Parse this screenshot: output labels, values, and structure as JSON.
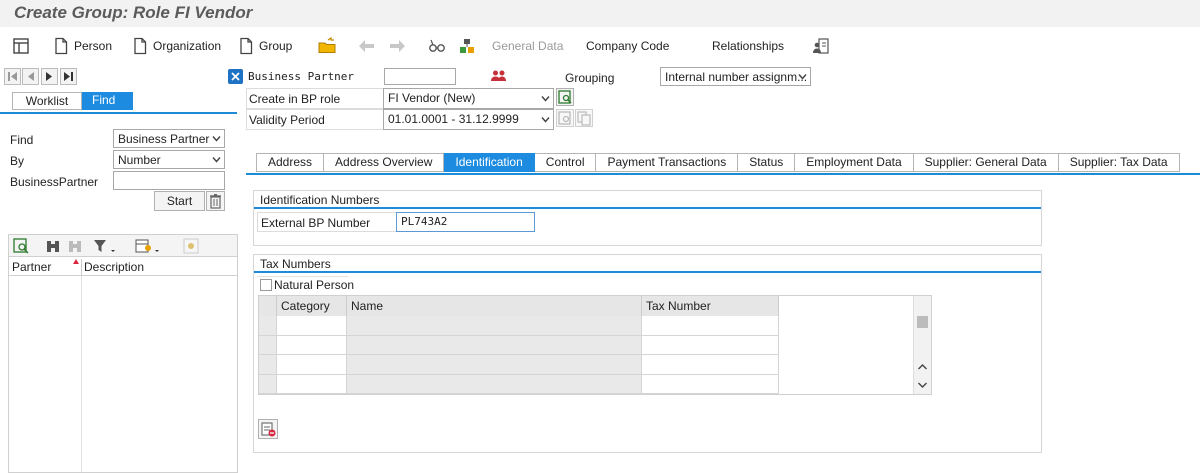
{
  "title": "Create Group: Role FI Vendor",
  "toolbar": {
    "person": "Person",
    "organization": "Organization",
    "group": "Group",
    "general_data": "General Data",
    "company_code": "Company Code",
    "relationships": "Relationships"
  },
  "left": {
    "worklist_tab": "Worklist",
    "find_tab": "Find",
    "find_label": "Find",
    "find_value": "Business Partner",
    "by_label": "By",
    "by_value": "Number",
    "bp_label": "BusinessPartner",
    "bp_value": "",
    "start_button": "Start",
    "col_partner": "Partner",
    "col_description": "Description"
  },
  "header": {
    "bp_label": "Business Partner",
    "bp_value": "",
    "grouping_label": "Grouping",
    "grouping_value": "Internal number assignm...",
    "role_label": "Create in BP role",
    "role_value": "FI Vendor (New)",
    "validity_label": "Validity Period",
    "validity_value": "01.01.0001 - 31.12.9999"
  },
  "tabs": [
    "Address",
    "Address Overview",
    "Identification",
    "Control",
    "Payment Transactions",
    "Status",
    "Employment Data",
    "Supplier: General Data",
    "Supplier: Tax Data"
  ],
  "active_tab_index": 2,
  "identification": {
    "section_title": "Identification Numbers",
    "ext_label": "External BP Number",
    "ext_value": "PL743A2"
  },
  "tax": {
    "section_title": "Tax Numbers",
    "natural_person_label": "Natural Person",
    "col_category": "Category",
    "col_name": "Name",
    "col_tax_number": "Tax Number"
  },
  "colors": {
    "accent": "#1d8ce0",
    "title_gray": "#5b5b5b"
  }
}
